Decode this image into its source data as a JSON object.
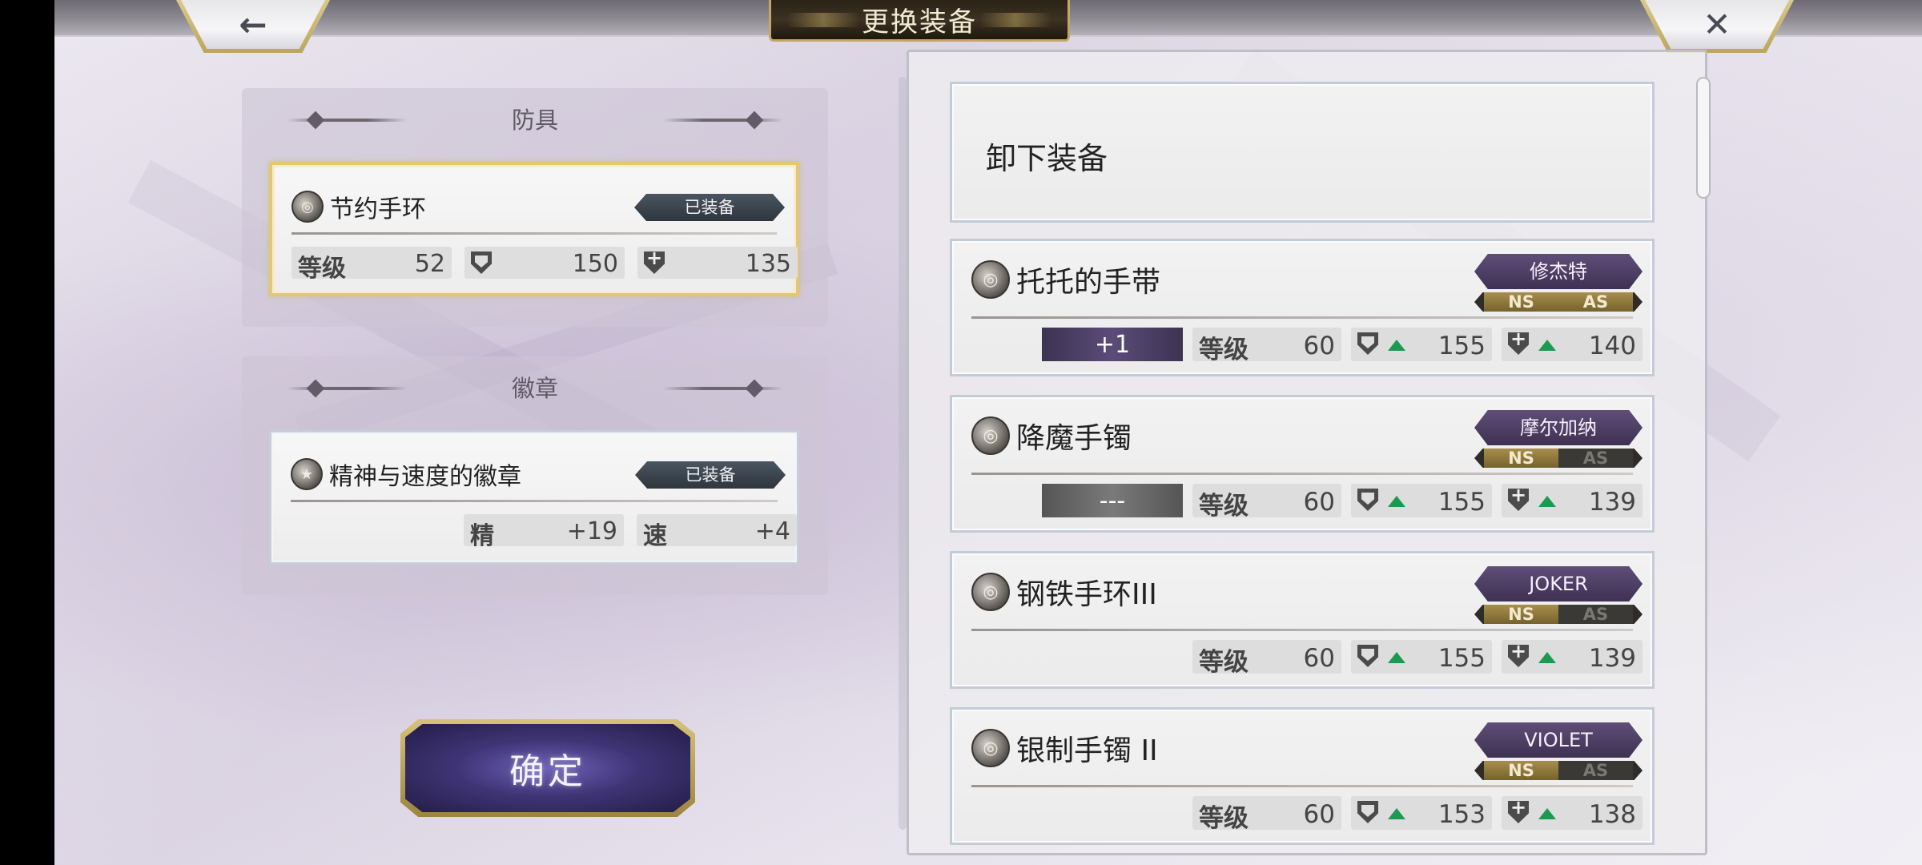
{
  "header": {
    "title": "更换装备",
    "back_icon": "←",
    "close_icon": "✕"
  },
  "armor_slot": {
    "heading": "防具",
    "item": {
      "name": "节约手环",
      "status": "已装备",
      "level_label": "等级",
      "level": "52",
      "defense": "150",
      "magic_defense": "135"
    }
  },
  "badge_slot": {
    "heading": "徽章",
    "item": {
      "name": "精神与速度的徽章",
      "status": "已装备",
      "stat1_label": "精",
      "stat1_value": "+19",
      "stat2_label": "速",
      "stat2_value": "+4"
    }
  },
  "confirm_label": "确定",
  "equipment_list": {
    "unequip_label": "卸下装备",
    "items": [
      {
        "name": "托托的手带",
        "owner": "修杰特",
        "ns": "NS",
        "as": "AS",
        "ns_active": true,
        "as_active": true,
        "refine": "+1",
        "level_label": "等级",
        "level": "60",
        "defense": "155",
        "magic_defense": "140"
      },
      {
        "name": "降魔手镯",
        "owner": "摩尔加纳",
        "ns": "NS",
        "as": "AS",
        "ns_active": true,
        "as_active": false,
        "refine": "---",
        "level_label": "等级",
        "level": "60",
        "defense": "155",
        "magic_defense": "139"
      },
      {
        "name": "钢铁手环III",
        "owner": "JOKER",
        "ns": "NS",
        "as": "AS",
        "ns_active": true,
        "as_active": false,
        "refine": "",
        "level_label": "等级",
        "level": "60",
        "defense": "155",
        "magic_defense": "139"
      },
      {
        "name": "银制手镯 II",
        "owner": "VIOLET",
        "ns": "NS",
        "as": "AS",
        "ns_active": true,
        "as_active": false,
        "refine": "",
        "level_label": "等级",
        "level": "60",
        "defense": "153",
        "magic_defense": "138"
      }
    ]
  },
  "colors": {
    "increase_arrow": "#1d9a52",
    "gold_accent": "#e3c774",
    "owner_tag": "#5f4e78"
  }
}
